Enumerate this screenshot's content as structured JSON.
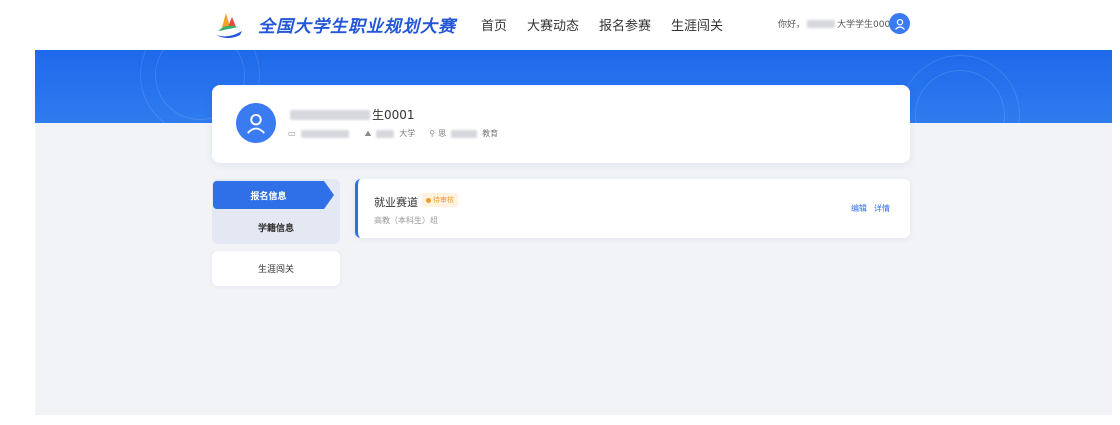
{
  "header": {
    "brand": "全国大学生职业规划大赛",
    "nav": [
      "首页",
      "大赛动态",
      "报名参赛",
      "生涯闯关"
    ],
    "greeting_prefix": "你好，",
    "greeting_suffix": "大学学生0001"
  },
  "profile": {
    "name_suffix": "生0001",
    "school_suffix": "大学",
    "major_prefix": "思",
    "major_suffix": "教育"
  },
  "menu": {
    "items": [
      "报名信息",
      "学籍信息",
      "生涯闯关"
    ]
  },
  "track": {
    "title": "就业赛道",
    "status": "待审核",
    "subtitle": "高教（本科生）组",
    "edit_label": "编辑",
    "detail_label": "详情"
  },
  "colors": {
    "primary": "#2f6fe8",
    "banner": "#1e69ea",
    "status": "#f29b2a"
  }
}
